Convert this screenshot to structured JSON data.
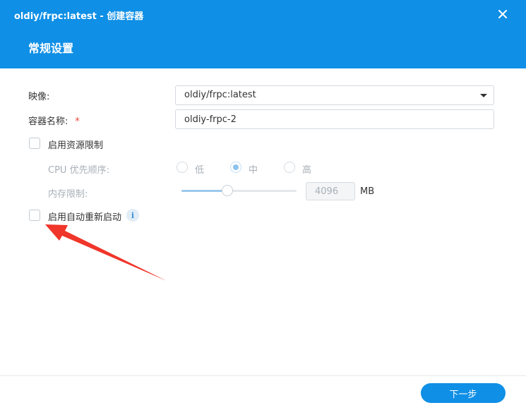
{
  "window": {
    "title": "oldiy/frpc:latest - 创建容器",
    "section_title": "常规设置"
  },
  "form": {
    "image_label": "映像:",
    "image_value": "oldiy/frpc:latest",
    "name_label": "容器名称:",
    "required_mark": "*",
    "name_value": "oldiy-frpc-2",
    "resource_limit_label": "启用资源限制",
    "resource_limit_checked": false,
    "cpu_priority_label": "CPU 优先顺序:",
    "cpu_priority_options": [
      {
        "label": "低",
        "checked": false
      },
      {
        "label": "中",
        "checked": true
      },
      {
        "label": "高",
        "checked": false
      }
    ],
    "memory_limit_label": "内存限制:",
    "memory_limit_value": "4096",
    "memory_limit_fraction": 0.4,
    "memory_unit": "MB",
    "auto_restart_label": "启用自动重新启动",
    "auto_restart_checked": false,
    "info_glyph": "i"
  },
  "footer": {
    "next_label": "下一步"
  },
  "colors": {
    "accent": "#0f8fe6",
    "annotation_arrow": "#f0352a",
    "required": "#e8473d"
  },
  "icons": {
    "close": "close-icon",
    "dropdown": "chevron-down-icon",
    "info": "info-icon",
    "annotation": "arrow-annotation"
  }
}
